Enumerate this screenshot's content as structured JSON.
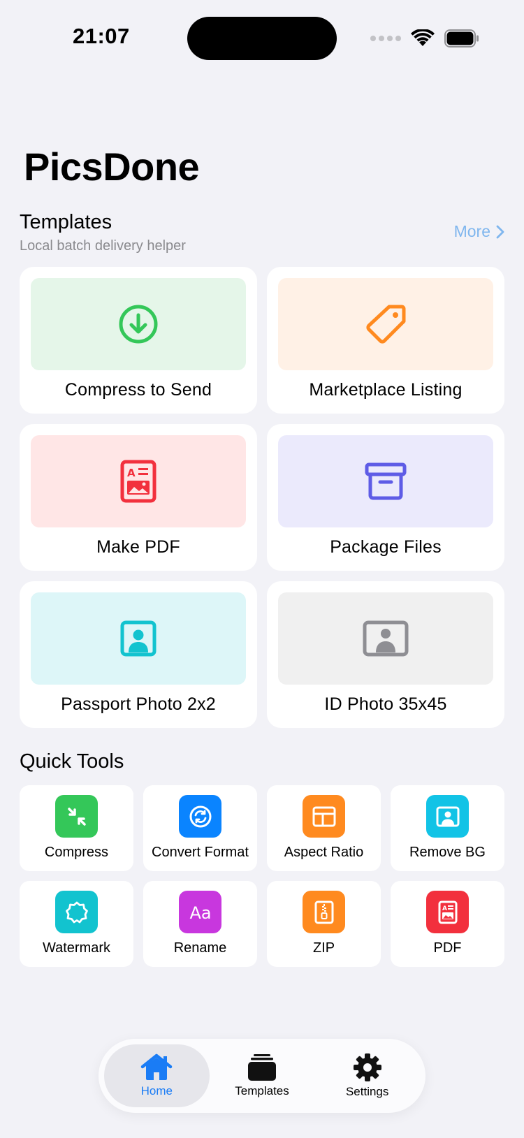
{
  "status_bar": {
    "time": "21:07"
  },
  "app_title": "PicsDone",
  "templates_section": {
    "title": "Templates",
    "subtitle": "Local batch delivery helper",
    "more_label": "More",
    "items": [
      {
        "label": "Compress to Send",
        "icon": "download-circle-icon",
        "bg": "#e5f6e9",
        "color": "#34c759"
      },
      {
        "label": "Marketplace Listing",
        "icon": "tag-icon",
        "bg": "#fff1e6",
        "color": "#ff8a1f"
      },
      {
        "label": "Make PDF",
        "icon": "pdf-document-icon",
        "bg": "#ffe6e6",
        "color": "#f2303d"
      },
      {
        "label": "Package Files",
        "icon": "archive-box-icon",
        "bg": "#ebeafc",
        "color": "#5e5ce6"
      },
      {
        "label": "Passport Photo 2x2",
        "icon": "portrait-icon",
        "bg": "#ddf6f8",
        "color": "#12c3cf"
      },
      {
        "label": "ID Photo 35x45",
        "icon": "id-photo-icon",
        "bg": "#f0f0f0",
        "color": "#8e8e93"
      }
    ]
  },
  "quick_tools": {
    "title": "Quick Tools",
    "items": [
      {
        "label": "Compress",
        "icon": "compress-arrows-icon",
        "color": "#34c759"
      },
      {
        "label": "Convert Format",
        "icon": "convert-cycle-icon",
        "color": "#0a84ff"
      },
      {
        "label": "Aspect Ratio",
        "icon": "aspect-ratio-icon",
        "color": "#ff8a1f"
      },
      {
        "label": "Remove BG",
        "icon": "remove-bg-icon",
        "color": "#12c3e6"
      },
      {
        "label": "Watermark",
        "icon": "watermark-seal-icon",
        "color": "#12c3cf"
      },
      {
        "label": "Rename",
        "icon": "rename-text-icon",
        "color": "#c837de"
      },
      {
        "label": "ZIP",
        "icon": "zip-file-icon",
        "color": "#ff8a1f"
      },
      {
        "label": "PDF",
        "icon": "pdf-file-icon",
        "color": "#f2303d"
      }
    ]
  },
  "tab_bar": {
    "tabs": [
      {
        "label": "Home",
        "icon": "house-icon",
        "active": true
      },
      {
        "label": "Templates",
        "icon": "stack-icon",
        "active": false
      },
      {
        "label": "Settings",
        "icon": "gear-icon",
        "active": false
      }
    ],
    "active_color": "#1a7cf5"
  }
}
